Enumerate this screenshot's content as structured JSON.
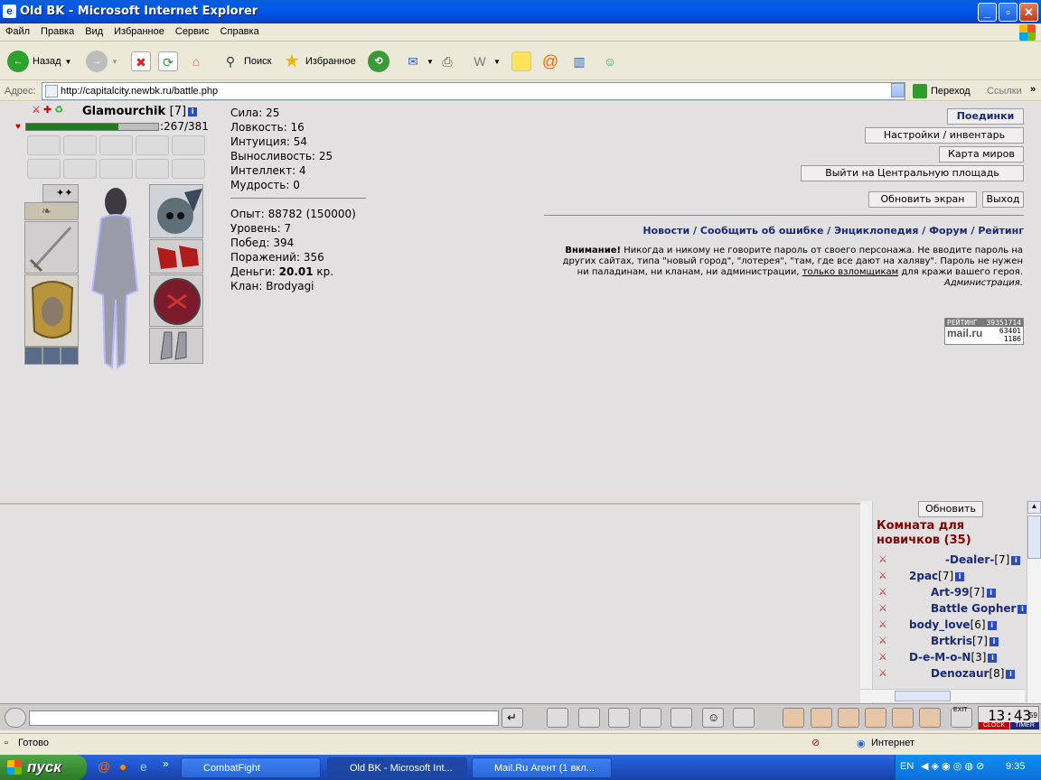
{
  "window": {
    "title": "Old BK - Microsoft Internet Explorer"
  },
  "menu": [
    "Файл",
    "Правка",
    "Вид",
    "Избранное",
    "Сервис",
    "Справка"
  ],
  "toolbar": {
    "back": "Назад",
    "search": "Поиск",
    "favorites": "Избранное"
  },
  "address": {
    "label": "Адрес:",
    "url": "http://capitalcity.newbk.ru/battle.php",
    "go": "Переход",
    "links": "Ссылки"
  },
  "character": {
    "name": "Glamourchik",
    "level": "[7]",
    "hp": ":267/381",
    "hp_fraction": 0.7
  },
  "stats": [
    {
      "label": "Сила: ",
      "value": "25"
    },
    {
      "label": "Ловкость: ",
      "value": "16"
    },
    {
      "label": "Интуиция: ",
      "value": "54"
    },
    {
      "label": "Выносливость: ",
      "value": "25"
    },
    {
      "label": "Интеллект: ",
      "value": "4"
    },
    {
      "label": "Мудрость: ",
      "value": "0"
    }
  ],
  "progress": [
    {
      "label": "Опыт: ",
      "value": "88782 (150000)"
    },
    {
      "label": "Уровень: ",
      "value": "7"
    },
    {
      "label": "Побед: ",
      "value": "394"
    },
    {
      "label": "Поражений: ",
      "value": "356"
    }
  ],
  "money": {
    "label": "Деньги: ",
    "value": "20.01",
    "unit": " кр."
  },
  "clan": {
    "label": "Клан: ",
    "value": "Brodyagi"
  },
  "buttons": {
    "duels": "Поединки",
    "settings": "Настройки / инвентарь",
    "map": "Карта миров",
    "exit_square": "Выйти на Центральную площадь",
    "refresh": "Обновить экран",
    "logout": "Выход"
  },
  "links": [
    "Новости",
    "Сообщить об ошибке",
    "Энциклопедия",
    "Форум",
    "Рейтинг"
  ],
  "warning": {
    "bold": "Внимание!",
    "text": " Никогда и никому не говорите пароль от своего персонажа. Не вводите пароль на других сайтах, типа \"новый город\", \"лотерея\", \"там, где все дают на халяву\". Пароль не нужен ни паладинам, ни кланам, ни администрации, ",
    "link": "только взломщикам",
    "tail": " для кражи вашего героя.",
    "sign": "Администрация."
  },
  "counter": {
    "label": "РЕЙТИНГ",
    "num1": "39351714",
    "num2": "63401",
    "num3": "1186",
    "brand": "mail.ru"
  },
  "online": {
    "refresh": "Обновить",
    "room": "Комната для новичков (35)",
    "users": [
      {
        "name": "-Dealer-",
        "level": "[7]"
      },
      {
        "name": "2pac",
        "level": "[7]"
      },
      {
        "name": "Art-99",
        "level": "[7]"
      },
      {
        "name": "Battle Gopher",
        "level": ""
      },
      {
        "name": "body_love",
        "level": "[6]"
      },
      {
        "name": "Brtkris",
        "level": "[7]"
      },
      {
        "name": "D-e-M-o-N",
        "level": "[3]"
      },
      {
        "name": "Denozaur",
        "level": "[8]"
      }
    ]
  },
  "clock": {
    "time": "13:43",
    "sec": "59",
    "label1": "CLOCK",
    "label2": "TIMER",
    "exit": "EXIT"
  },
  "status": {
    "text": "Готово",
    "zone": "Интернет"
  },
  "taskbar": {
    "start": "пуск",
    "tasks": [
      "CombatFight",
      "Old BK - Microsoft Int...",
      "Mail.Ru Агент (1 вкл..."
    ],
    "lang": "EN",
    "time": "9:35"
  }
}
